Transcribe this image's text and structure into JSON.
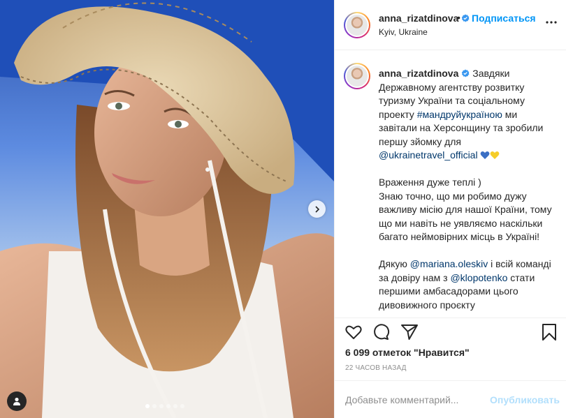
{
  "post": {
    "username": "anna_rizatdinova",
    "separator": "•",
    "follow_label": "Подписаться",
    "location": "Kyiv, Ukraine",
    "caption": {
      "p1_text": "Завдяки Державному агентству розвитку туризму України та соціальному проекту",
      "hashtag": "#мандруйукраїною",
      "p1_text2": "ми завітали на Херсонщину та зробили першу зйомку для",
      "mention1": "@ukrainetravel_official",
      "p2": "Враження дуже теплі )",
      "p3": "Знаю точно, що ми робимо дужу важливу місію для нашої Країни, тому що ми навіть не уявляємо наскільки багато неймовірних місць в Україні!",
      "p4_a": "Дякую",
      "mention2": "@mariana.oleskiv",
      "p4_b": "і всій команді за довіру нам з",
      "mention3": "@klopotenko",
      "p4_c": "стати першими амбасадорами цього дивовижного проєкту"
    },
    "likes_text": "6 099 отметок \"Нравится\"",
    "time_text": "22 ЧАСОВ НАЗАД",
    "comment_placeholder": "Добавьте комментарий...",
    "publish_label": "Опубликовать",
    "carousel": {
      "total": 6,
      "active_index": 0
    }
  },
  "icons": {
    "verified": "verified-badge-icon",
    "more": "more-options-icon",
    "like": "heart-icon",
    "comment": "comment-icon",
    "share": "share-icon",
    "save": "bookmark-icon",
    "next": "chevron-right-icon",
    "tag": "user-tag-icon"
  },
  "colors": {
    "link": "#00376b",
    "follow": "#0095f6",
    "publish_disabled": "#b2dffc",
    "muted": "#8e8e8e",
    "ukraine_blue": "#0057b7",
    "ukraine_yellow": "#ffd700"
  }
}
